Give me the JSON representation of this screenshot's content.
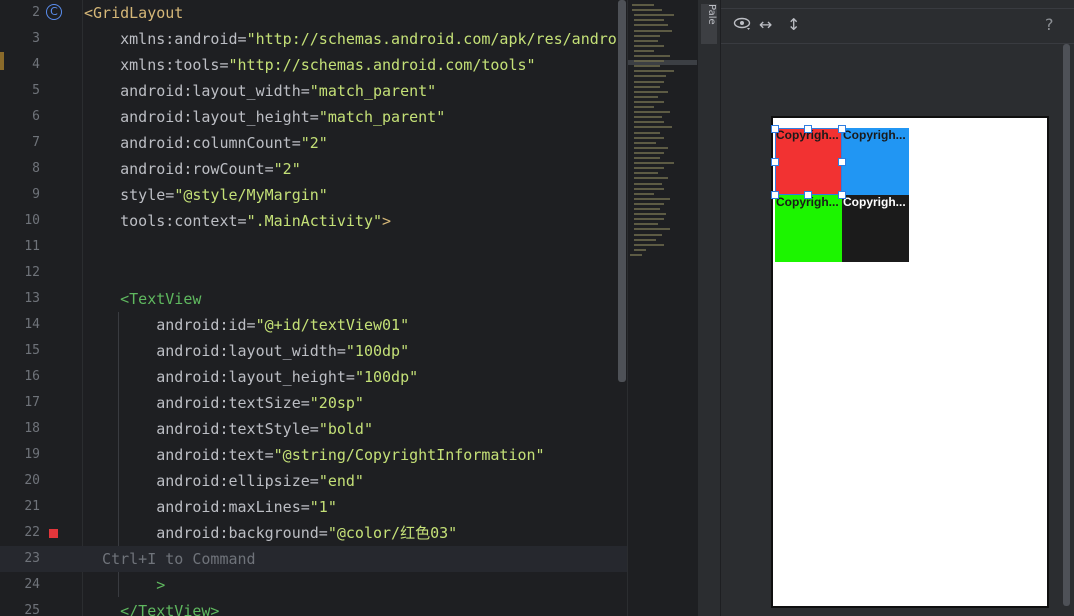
{
  "editor": {
    "lines": [
      {
        "n": "2",
        "segments": [
          {
            "t": "<GridLayout",
            "c": "tag"
          }
        ],
        "marker": "class-icon"
      },
      {
        "n": "3",
        "segments": [
          {
            "t": "    xmlns:android=",
            "c": "attr"
          },
          {
            "t": "\"http://schemas.android.com/apk/res/androi",
            "c": "val"
          }
        ]
      },
      {
        "n": "4",
        "segments": [
          {
            "t": "    xmlns:tools=",
            "c": "attr"
          },
          {
            "t": "\"http://schemas.android.com/tools\"",
            "c": "val"
          }
        ]
      },
      {
        "n": "5",
        "segments": [
          {
            "t": "    android:layout_width=",
            "c": "attr"
          },
          {
            "t": "\"match_parent\"",
            "c": "val"
          }
        ]
      },
      {
        "n": "6",
        "segments": [
          {
            "t": "    android:layout_height=",
            "c": "attr"
          },
          {
            "t": "\"match_parent\"",
            "c": "val"
          }
        ]
      },
      {
        "n": "7",
        "segments": [
          {
            "t": "    android:columnCount=",
            "c": "attr"
          },
          {
            "t": "\"2\"",
            "c": "val"
          }
        ]
      },
      {
        "n": "8",
        "segments": [
          {
            "t": "    android:rowCount=",
            "c": "attr"
          },
          {
            "t": "\"2\"",
            "c": "val"
          }
        ]
      },
      {
        "n": "9",
        "segments": [
          {
            "t": "    style=",
            "c": "attr"
          },
          {
            "t": "\"@style/MyMargin\"",
            "c": "val"
          }
        ]
      },
      {
        "n": "10",
        "segments": [
          {
            "t": "    tools:context=",
            "c": "attr"
          },
          {
            "t": "\".MainActivity\"",
            "c": "val"
          },
          {
            "t": ">",
            "c": "tag"
          }
        ]
      },
      {
        "n": "11",
        "segments": []
      },
      {
        "n": "12",
        "segments": []
      },
      {
        "n": "13",
        "segments": [
          {
            "t": "    <TextView",
            "c": "tag-green"
          }
        ]
      },
      {
        "n": "14",
        "segments": [
          {
            "t": "        android:id=",
            "c": "attr"
          },
          {
            "t": "\"@+id/textView01\"",
            "c": "val"
          }
        ]
      },
      {
        "n": "15",
        "segments": [
          {
            "t": "        android:layout_width=",
            "c": "attr"
          },
          {
            "t": "\"100dp\"",
            "c": "val"
          }
        ]
      },
      {
        "n": "16",
        "segments": [
          {
            "t": "        android:layout_height=",
            "c": "attr"
          },
          {
            "t": "\"100dp\"",
            "c": "val"
          }
        ]
      },
      {
        "n": "17",
        "segments": [
          {
            "t": "        android:textSize=",
            "c": "attr"
          },
          {
            "t": "\"20sp\"",
            "c": "val"
          }
        ]
      },
      {
        "n": "18",
        "segments": [
          {
            "t": "        android:textStyle=",
            "c": "attr"
          },
          {
            "t": "\"bold\"",
            "c": "val"
          }
        ]
      },
      {
        "n": "19",
        "segments": [
          {
            "t": "        android:text=",
            "c": "attr"
          },
          {
            "t": "\"@string/CopyrightInformation\"",
            "c": "val"
          }
        ]
      },
      {
        "n": "20",
        "segments": [
          {
            "t": "        android:ellipsize=",
            "c": "attr"
          },
          {
            "t": "\"end\"",
            "c": "val"
          }
        ]
      },
      {
        "n": "21",
        "segments": [
          {
            "t": "        android:maxLines=",
            "c": "attr"
          },
          {
            "t": "\"1\"",
            "c": "val"
          }
        ]
      },
      {
        "n": "22",
        "segments": [
          {
            "t": "        android:background=",
            "c": "attr"
          },
          {
            "t": "\"@color/红色03\"",
            "c": "val"
          }
        ],
        "marker": "red-square"
      },
      {
        "n": "23",
        "segments": [
          {
            "t": "  Ctrl+I to Command",
            "c": "hint"
          }
        ],
        "current": true
      },
      {
        "n": "24",
        "segments": [
          {
            "t": "        >",
            "c": "tag-green"
          }
        ]
      },
      {
        "n": "25",
        "segments": [
          {
            "t": "    </TextView>",
            "c": "tag-green"
          }
        ]
      }
    ]
  },
  "palette": {
    "label": "Pale"
  },
  "design_toolbar": {
    "eye_icon": "eye-icon",
    "h_icon": "↔",
    "v_icon": "↕",
    "help": "?"
  },
  "preview": {
    "cells": [
      {
        "text": "Copyrigh...",
        "bg": "#f23232",
        "fg": "#1a1a1a"
      },
      {
        "text": "Copyrigh...",
        "bg": "#2196f3",
        "fg": "#1a1a1a"
      },
      {
        "text": "Copyrigh...",
        "bg": "#1cf500",
        "fg": "#1a1a1a"
      },
      {
        "text": "Copyrigh...",
        "bg": "#1b1b1b",
        "fg": "#ffffff"
      }
    ]
  }
}
